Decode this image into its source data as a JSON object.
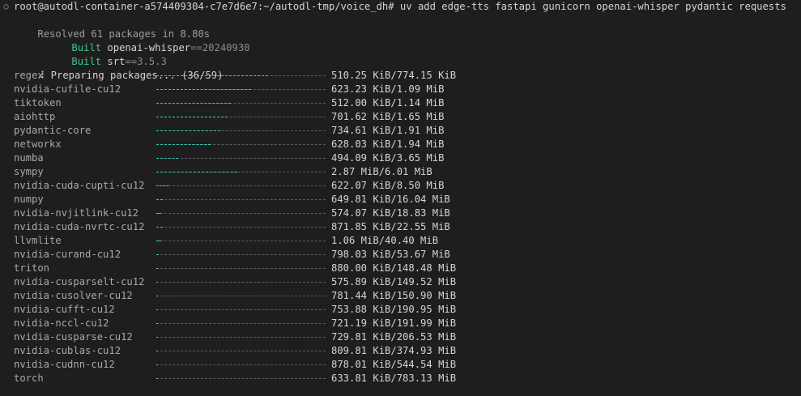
{
  "colors": {
    "background": "#1e1e1e",
    "text": "#cccccc",
    "built_keyword": "#3fc68b",
    "progress_fill": "#3cc9b3",
    "progress_track": "#5a5a5a"
  },
  "prompt": {
    "marker_icon": "circle-outline-icon",
    "text": "root@autodl-container-a574409304-c7e7d6e7:~/autodl-tmp/voice_dh# uv add edge-tts fastapi gunicorn openai-whisper pydantic requests"
  },
  "resolved": "Resolved 61 packages in 8.80s",
  "builds": [
    {
      "keyword": "Built",
      "name": "openai-whisper",
      "sep": "==",
      "version": "20240930"
    },
    {
      "keyword": "Built",
      "name": "srt",
      "sep": "==",
      "version": "3.5.3"
    }
  ],
  "preparing": {
    "spinner": "⠼",
    "text": "Preparing packages... (36/59)"
  },
  "packages": [
    {
      "name": "regex",
      "size": "510.25 KiB/774.15 KiB",
      "progress": 0.66
    },
    {
      "name": "nvidia-cufile-cu12",
      "size": "623.23 KiB/1.09 MiB",
      "progress": 0.56
    },
    {
      "name": "tiktoken",
      "size": "512.00 KiB/1.14 MiB",
      "progress": 0.44
    },
    {
      "name": "aiohttp",
      "size": "701.62 KiB/1.65 MiB",
      "progress": 0.42
    },
    {
      "name": "pydantic-core",
      "size": "734.61 KiB/1.91 MiB",
      "progress": 0.38
    },
    {
      "name": "networkx",
      "size": "628.03 KiB/1.94 MiB",
      "progress": 0.32
    },
    {
      "name": "numba",
      "size": "494.09 KiB/3.65 MiB",
      "progress": 0.13
    },
    {
      "name": "sympy",
      "size": "2.87 MiB/6.01 MiB",
      "progress": 0.48
    },
    {
      "name": "nvidia-cuda-cupti-cu12",
      "size": "622.07 KiB/8.50 MiB",
      "progress": 0.07
    },
    {
      "name": "numpy",
      "size": "649.81 KiB/16.04 MiB",
      "progress": 0.04
    },
    {
      "name": "nvidia-nvjitlink-cu12",
      "size": "574.07 KiB/18.83 MiB",
      "progress": 0.03
    },
    {
      "name": "nvidia-cuda-nvrtc-cu12",
      "size": "871.85 KiB/22.55 MiB",
      "progress": 0.04
    },
    {
      "name": "llvmlite",
      "size": "1.06 MiB/40.40 MiB",
      "progress": 0.03
    },
    {
      "name": "nvidia-curand-cu12",
      "size": "798.03 KiB/53.67 MiB",
      "progress": 0.015
    },
    {
      "name": "triton",
      "size": "880.00 KiB/148.48 MiB",
      "progress": 0.006
    },
    {
      "name": "nvidia-cusparselt-cu12",
      "size": "575.89 KiB/149.52 MiB",
      "progress": 0.004
    },
    {
      "name": "nvidia-cusolver-cu12",
      "size": "781.44 KiB/150.90 MiB",
      "progress": 0.005
    },
    {
      "name": "nvidia-cufft-cu12",
      "size": "753.88 KiB/190.95 MiB",
      "progress": 0.004
    },
    {
      "name": "nvidia-nccl-cu12",
      "size": "721.19 KiB/191.99 MiB",
      "progress": 0.004
    },
    {
      "name": "nvidia-cusparse-cu12",
      "size": "729.81 KiB/206.53 MiB",
      "progress": 0.003
    },
    {
      "name": "nvidia-cublas-cu12",
      "size": "809.81 KiB/374.93 MiB",
      "progress": 0.002
    },
    {
      "name": "nvidia-cudnn-cu12",
      "size": "878.01 KiB/544.54 MiB",
      "progress": 0.002
    },
    {
      "name": "torch",
      "size": "633.81 KiB/783.13 MiB",
      "progress": 0.001
    }
  ]
}
